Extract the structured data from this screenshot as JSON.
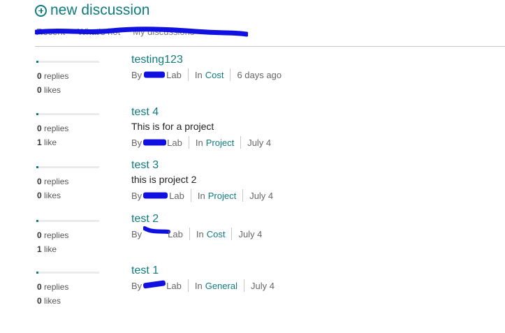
{
  "header": {
    "new_discussion_label": "new discussion",
    "plus_icon": "plus-circle-icon"
  },
  "tabs": [
    "Recent",
    "What's hot",
    "My discussions"
  ],
  "colors": {
    "accent": "#0f7b7d",
    "redaction": "#1010e0"
  },
  "discussions": [
    {
      "title": "testing123",
      "body": "",
      "replies_num": "0",
      "replies_label": "replies",
      "likes_num": "0",
      "likes_label": "likes",
      "by_label": "By",
      "author": "Lab",
      "in_label": "In",
      "category": "Cost",
      "time": "6 days ago"
    },
    {
      "title": "test 4",
      "body": "This is for a project",
      "replies_num": "0",
      "replies_label": "replies",
      "likes_num": "1",
      "likes_label": "like",
      "by_label": "By",
      "author": "Lab",
      "in_label": "In",
      "category": "Project",
      "time": "July 4"
    },
    {
      "title": "test 3",
      "body": "this is project 2",
      "replies_num": "0",
      "replies_label": "replies",
      "likes_num": "0",
      "likes_label": "likes",
      "by_label": "By",
      "author": "Lab",
      "in_label": "In",
      "category": "Project",
      "time": "July 4"
    },
    {
      "title": "test 2",
      "body": "",
      "replies_num": "0",
      "replies_label": "replies",
      "likes_num": "1",
      "likes_label": "like",
      "by_label": "By",
      "author": "Lab",
      "in_label": "In",
      "category": "Cost",
      "time": "July 4"
    },
    {
      "title": "test 1",
      "body": "",
      "replies_num": "0",
      "replies_label": "replies",
      "likes_num": "0",
      "likes_label": "likes",
      "by_label": "By",
      "author": "Lab",
      "in_label": "In",
      "category": "General",
      "time": "July 4"
    }
  ]
}
